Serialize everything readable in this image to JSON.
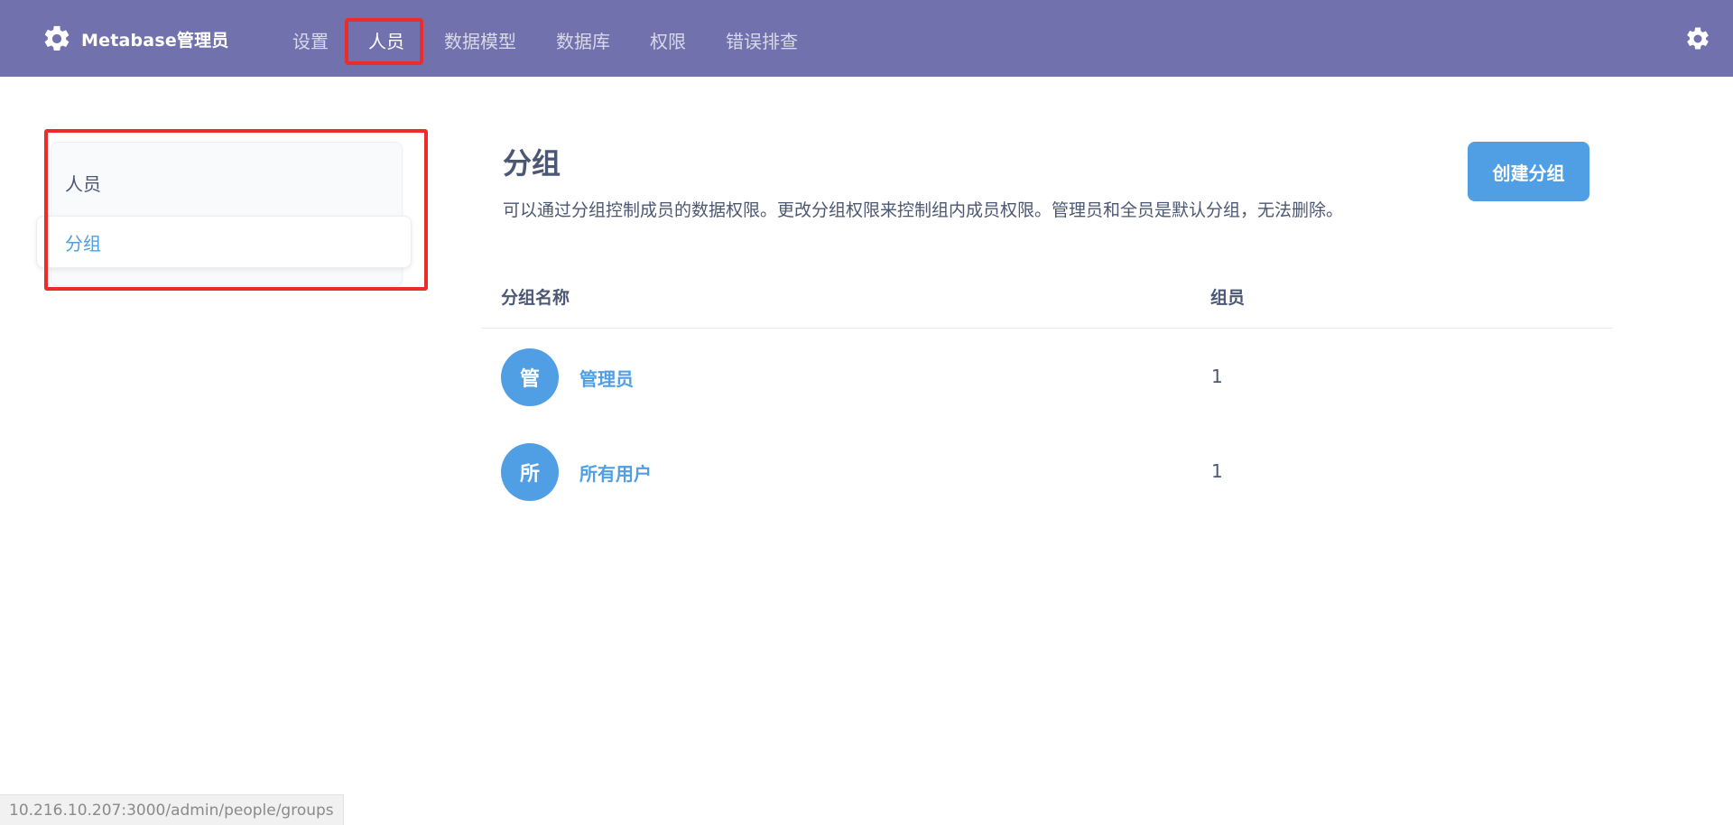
{
  "header": {
    "brand_label": "Metabase管理员",
    "nav": [
      {
        "label": "设置"
      },
      {
        "label": "人员"
      },
      {
        "label": "数据模型"
      },
      {
        "label": "数据库"
      },
      {
        "label": "权限"
      },
      {
        "label": "错误排查"
      }
    ],
    "active_nav": "人员"
  },
  "sidebar": {
    "items": [
      {
        "label": "人员"
      },
      {
        "label": "分组"
      }
    ],
    "active": "分组"
  },
  "main": {
    "title": "分组",
    "description": "可以通过分组控制成员的数据权限。更改分组权限来控制组内成员权限。管理员和全员是默认分组，无法删除。",
    "create_button": "创建分组",
    "columns": [
      "分组名称",
      "组员"
    ],
    "groups": [
      {
        "initial": "管",
        "name": "管理员",
        "members": "1"
      },
      {
        "initial": "所",
        "name": "所有用户",
        "members": "1"
      }
    ]
  },
  "status_bar": {
    "url": "10.216.10.207:3000/admin/people/groups"
  },
  "colors": {
    "header_bg": "#7172ad",
    "accent": "#509ee3",
    "highlight_box": "#ea2d2a",
    "text": "#4c5773"
  }
}
